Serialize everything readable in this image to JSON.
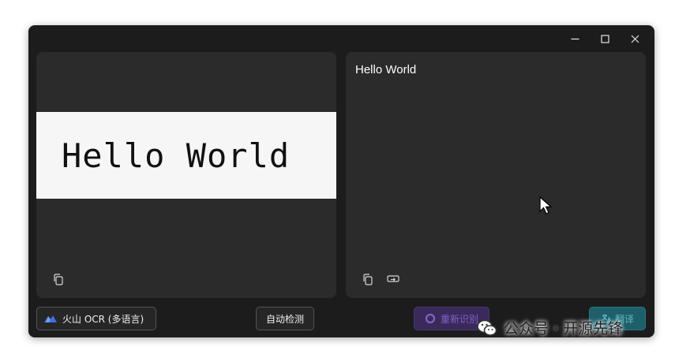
{
  "window": {
    "controls": [
      "minimize",
      "maximize",
      "close"
    ]
  },
  "source_panel": {
    "image_text": "Hello World",
    "copy_icon": "copy-icon"
  },
  "result_panel": {
    "text": "Hello World",
    "copy_icon": "copy-icon",
    "replace_icon": "replace-icon"
  },
  "bottom_bar": {
    "engine_label": "火山 OCR (多语言)",
    "engine_icon": "volcano-icon",
    "detect_label": "自动检测",
    "retry_label": "重新识别",
    "retry_icon": "refresh-icon",
    "translate_label": "翻译",
    "translate_icon": "translate-icon"
  },
  "watermark": {
    "text": "公众号 · 开源先锋",
    "icon": "wechat-icon"
  },
  "colors": {
    "window_bg": "#1c1c1c",
    "panel_bg": "#2b2b2b",
    "image_bg": "#f6f6f6",
    "retry_accent": "#7e63c9",
    "translate_accent": "#63b8c8"
  }
}
